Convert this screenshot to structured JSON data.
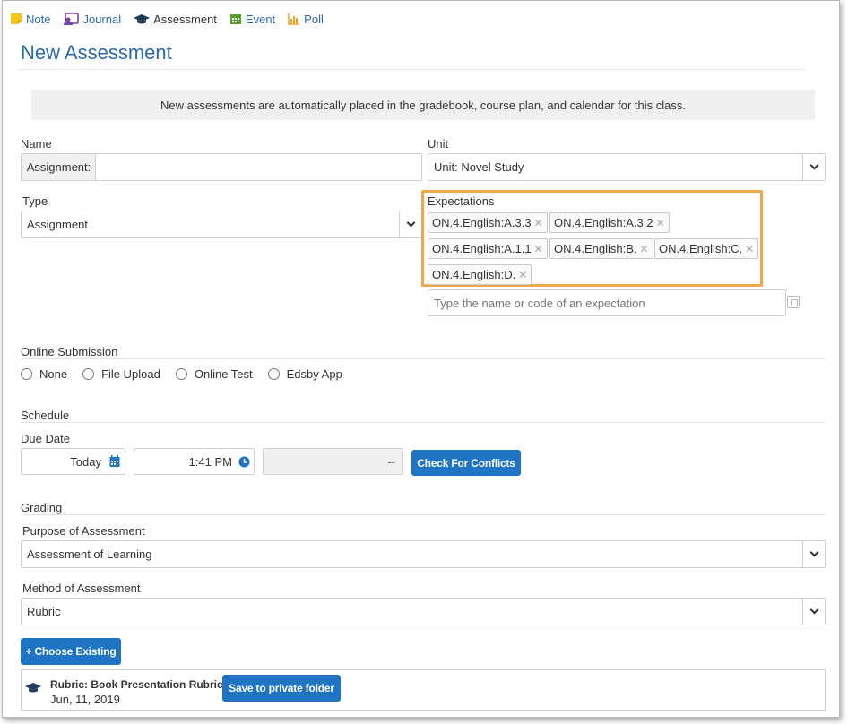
{
  "toolbar": {
    "items": [
      {
        "label": "Note",
        "icon": "note-icon",
        "color": "#f5c518"
      },
      {
        "label": "Journal",
        "icon": "journal-icon",
        "color": "#7a3fb0"
      },
      {
        "label": "Assessment",
        "icon": "graduation-cap-icon",
        "color": "#1f3b57"
      },
      {
        "label": "Event",
        "icon": "calendar-icon",
        "color": "#5aa02c"
      },
      {
        "label": "Poll",
        "icon": "bar-chart-icon",
        "color": "#f0a020"
      }
    ]
  },
  "page": {
    "title": "New Assessment",
    "info": "New assessments are automatically placed in the gradebook, course plan, and calendar for this class."
  },
  "form": {
    "name_label": "Name",
    "name_prefix": "Assignment:",
    "name_value": "",
    "unit_label": "Unit",
    "unit_value": "Unit: Novel Study",
    "type_label": "Type",
    "type_value": "Assignment",
    "expectations_label": "Expectations",
    "expectations": [
      "ON.4.English:A.3.3",
      "ON.4.English:A.3.2",
      "ON.4.English:A.1.1",
      "ON.4.English:B.",
      "ON.4.English:C.",
      "ON.4.English:D."
    ],
    "expectation_placeholder": "Type the name or code of an expectation",
    "online_submission_label": "Online Submission",
    "submission_options": [
      "None",
      "File Upload",
      "Online Test",
      "Edsby App"
    ],
    "schedule_label": "Schedule",
    "due_date_label": "Due Date",
    "due_date_value": "Today",
    "due_time_value": "1:41 PM",
    "duration_value": "--",
    "check_conflicts_label": "Check For Conflicts",
    "grading_label": "Grading",
    "purpose_label": "Purpose of Assessment",
    "purpose_value": "Assessment of Learning",
    "method_label": "Method of Assessment",
    "method_value": "Rubric",
    "choose_existing_label": "+ Choose Existing",
    "rubric": {
      "title": "Rubric: Book Presentation Rubric",
      "date": "Jun, 11, 2019",
      "save_label": "Save to private folder"
    }
  },
  "colors": {
    "accent": "#2a6aad",
    "button": "#1f74c3",
    "highlight": "#f0a64b"
  }
}
